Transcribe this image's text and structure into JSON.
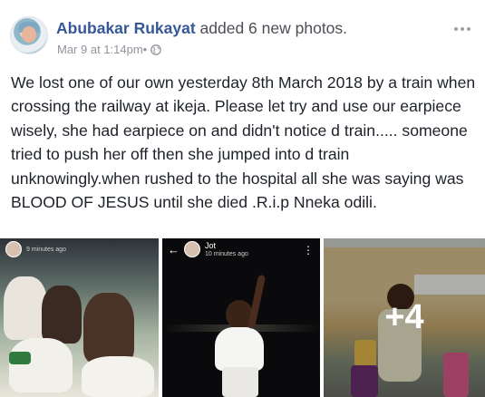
{
  "post": {
    "author": "Abubakar Rukayat",
    "action": " added 6 new photos.",
    "date": "Mar 9 at 1:14pm",
    "separator": " • ",
    "privacy_icon": "globe-icon",
    "body": "We lost one of our own yesterday 8th March 2018 by a train when crossing the railway at ikeja. Please let try and use  our earpiece wisely, she had earpiece on and didn't notice d train..... someone tried to push her off then she jumped into d train unknowingly.when rushed to the hospital all she was saying was BLOOD OF JESUS until she died .R.i.p Nneka odili."
  },
  "photos": {
    "photo1": {
      "story_time": "9 minutes ago"
    },
    "photo2": {
      "story_name": "Jot",
      "story_time": "10 minutes ago"
    },
    "photo3": {
      "more_count": "+4"
    }
  },
  "colors": {
    "author": "#365899",
    "meta": "#90949c",
    "text": "#1d2129"
  }
}
